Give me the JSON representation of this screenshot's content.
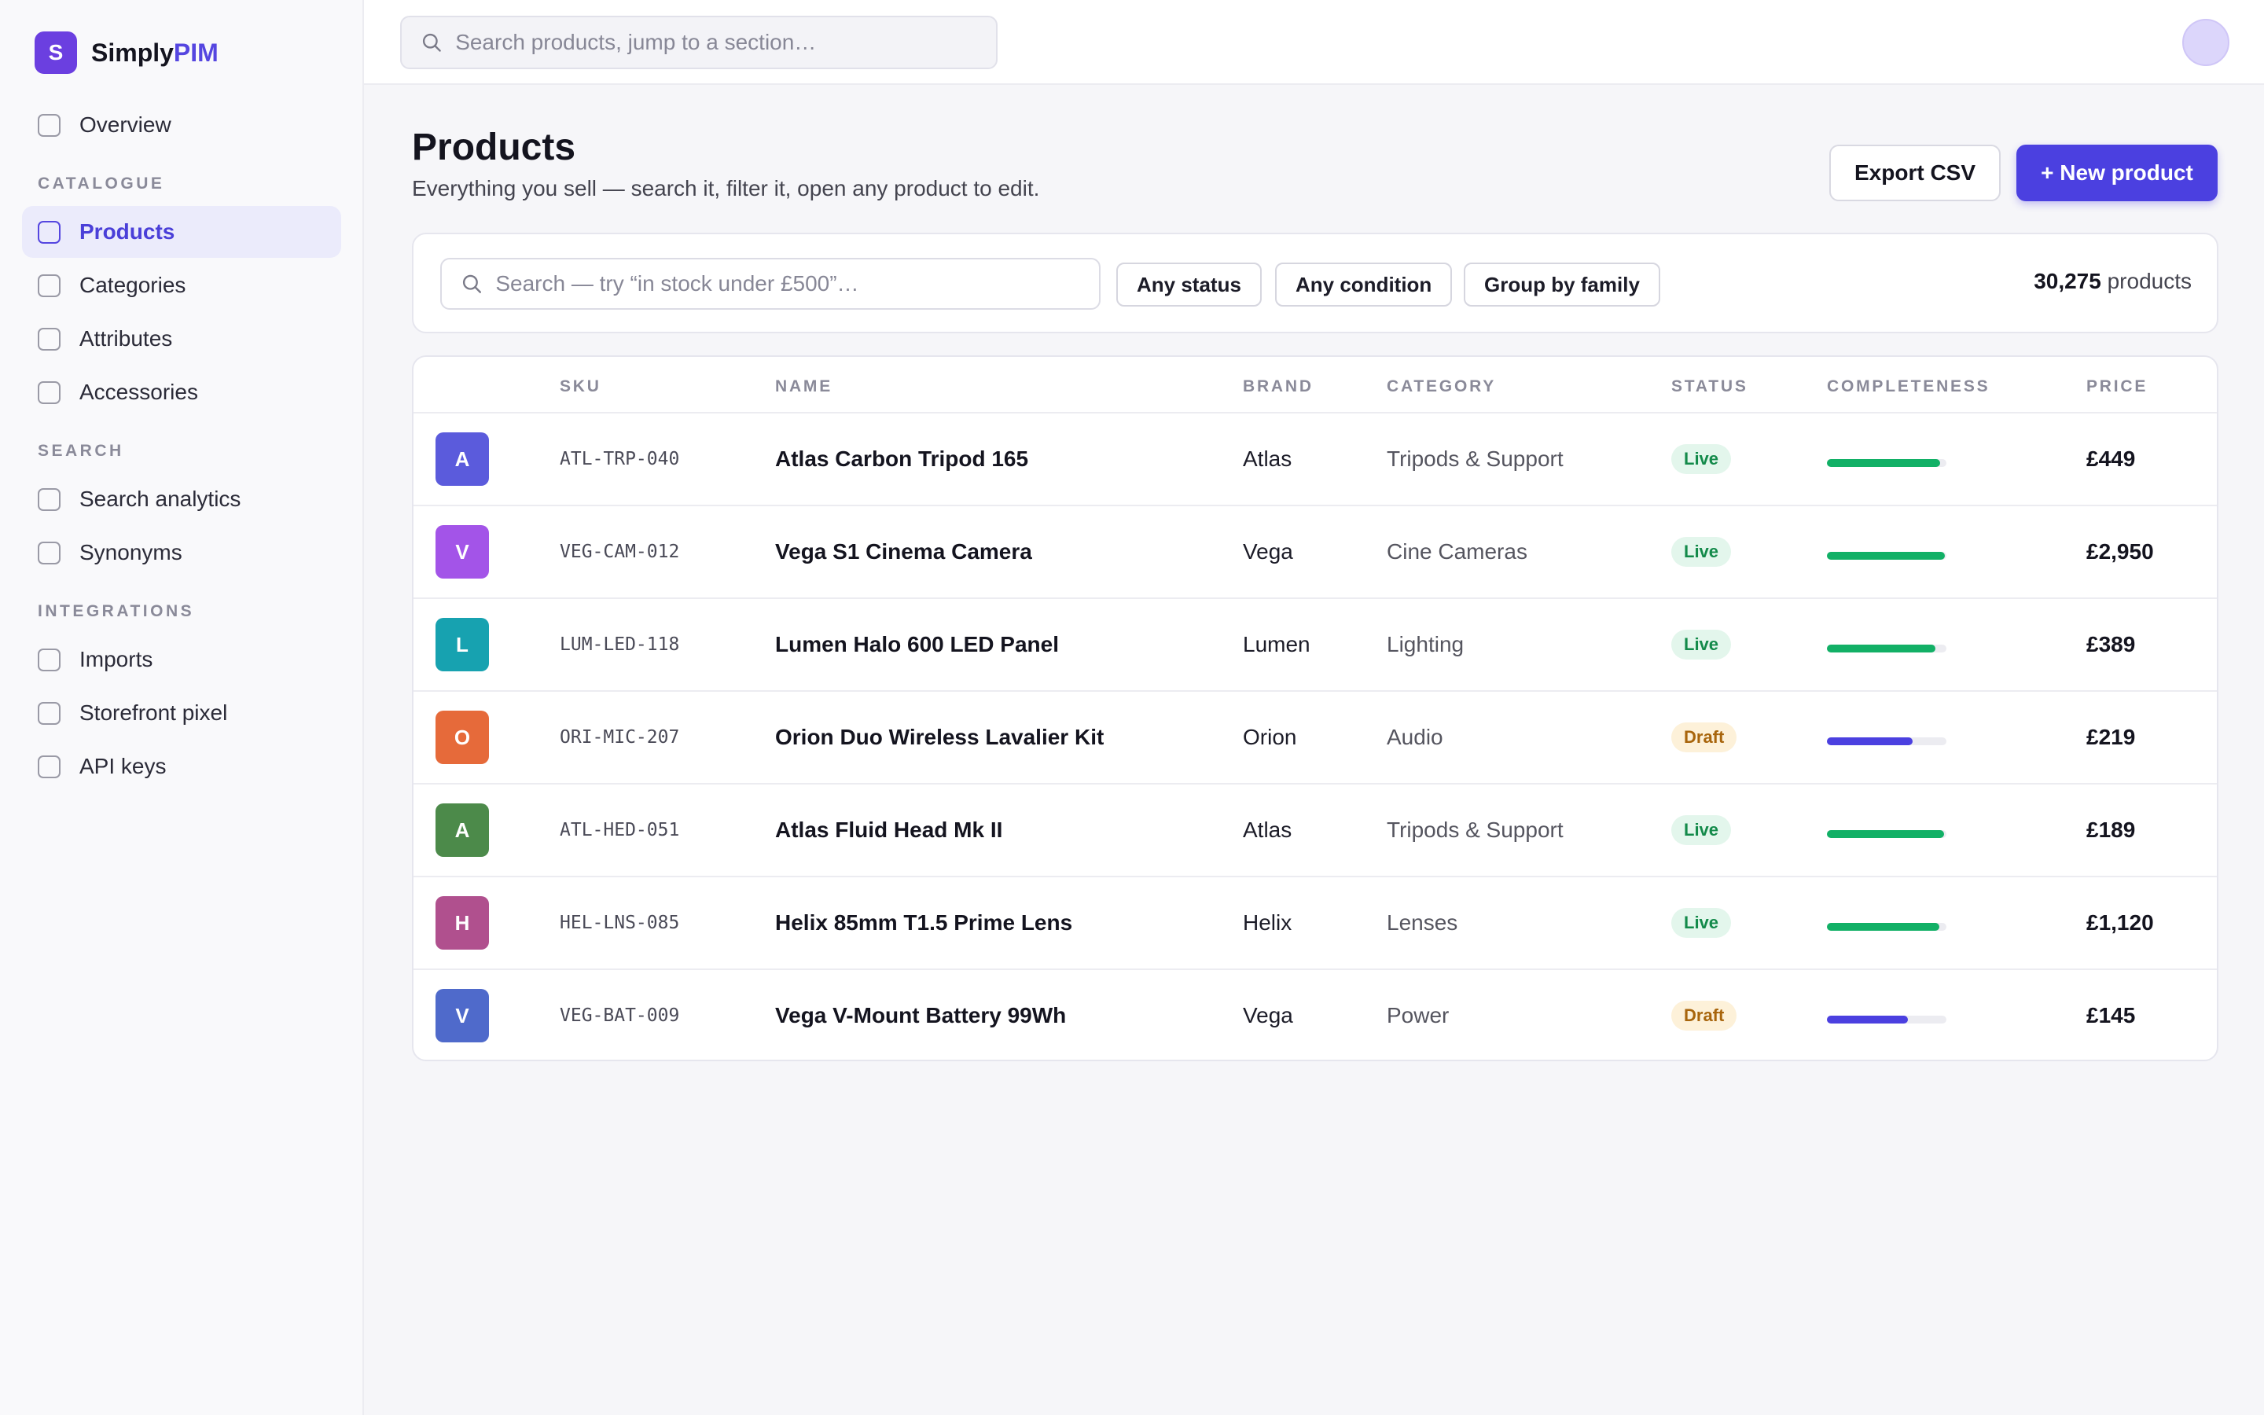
{
  "brand": {
    "logo_letter": "S",
    "name_part1": "Simply",
    "name_part2": "PIM"
  },
  "topbar": {
    "search_placeholder": "Search products, jump to a section…"
  },
  "sidebar": {
    "sections": [
      {
        "heading": "",
        "items": [
          {
            "label": "Overview",
            "active": false
          }
        ]
      },
      {
        "heading": "CATALOGUE",
        "items": [
          {
            "label": "Products",
            "active": true
          },
          {
            "label": "Categories",
            "active": false
          },
          {
            "label": "Attributes",
            "active": false
          },
          {
            "label": "Accessories",
            "active": false
          }
        ]
      },
      {
        "heading": "SEARCH",
        "items": [
          {
            "label": "Search analytics",
            "active": false
          },
          {
            "label": "Synonyms",
            "active": false
          }
        ]
      },
      {
        "heading": "INTEGRATIONS",
        "items": [
          {
            "label": "Imports",
            "active": false
          },
          {
            "label": "Storefront pixel",
            "active": false
          },
          {
            "label": "API keys",
            "active": false
          }
        ]
      }
    ]
  },
  "page": {
    "title": "Products",
    "subtitle": "Everything you sell — search it, filter it, open any product to edit.",
    "export_label": "Export CSV",
    "new_label": "+ New product"
  },
  "filters": {
    "search_placeholder": "Search — try “in stock under £500”…",
    "chips": [
      "Any status",
      "Any condition",
      "Group by family"
    ],
    "count_number": "30,275",
    "count_suffix": " products"
  },
  "table": {
    "columns": [
      "SKU",
      "NAME",
      "BRAND",
      "CATEGORY",
      "STATUS",
      "COMPLETENESS",
      "PRICE"
    ],
    "rows": [
      {
        "letter": "A",
        "color": "#5b5bdc",
        "sku": "ATL-TRP-040",
        "name": "Atlas Carbon Tripod 165",
        "brand": "Atlas",
        "category": "Tripods & Support",
        "status": "Live",
        "completeness": 0.95,
        "price": "£449"
      },
      {
        "letter": "V",
        "color": "#a354e8",
        "sku": "VEG-CAM-012",
        "name": "Vega S1 Cinema Camera",
        "brand": "Vega",
        "category": "Cine Cameras",
        "status": "Live",
        "completeness": 0.99,
        "price": "£2,950"
      },
      {
        "letter": "L",
        "color": "#17a2b0",
        "sku": "LUM-LED-118",
        "name": "Lumen Halo 600 LED Panel",
        "brand": "Lumen",
        "category": "Lighting",
        "status": "Live",
        "completeness": 0.91,
        "price": "£389"
      },
      {
        "letter": "O",
        "color": "#e66a3a",
        "sku": "ORI-MIC-207",
        "name": "Orion Duo Wireless Lavalier Kit",
        "brand": "Orion",
        "category": "Audio",
        "status": "Draft",
        "completeness": 0.72,
        "price": "£219"
      },
      {
        "letter": "A",
        "color": "#4c8a4a",
        "sku": "ATL-HED-051",
        "name": "Atlas Fluid Head Mk II",
        "brand": "Atlas",
        "category": "Tripods & Support",
        "status": "Live",
        "completeness": 0.98,
        "price": "£189"
      },
      {
        "letter": "H",
        "color": "#b0508e",
        "sku": "HEL-LNS-085",
        "name": "Helix 85mm T1.5 Prime Lens",
        "brand": "Helix",
        "category": "Lenses",
        "status": "Live",
        "completeness": 0.94,
        "price": "£1,120"
      },
      {
        "letter": "V",
        "color": "#4f6acb",
        "sku": "VEG-BAT-009",
        "name": "Vega V-Mount Battery 99Wh",
        "brand": "Vega",
        "category": "Power",
        "status": "Draft",
        "completeness": 0.68,
        "price": "£145"
      }
    ]
  },
  "colors": {
    "accent": "#4b40e0",
    "live_bar": "#12b066",
    "draft_bar": "#4b40e0"
  }
}
